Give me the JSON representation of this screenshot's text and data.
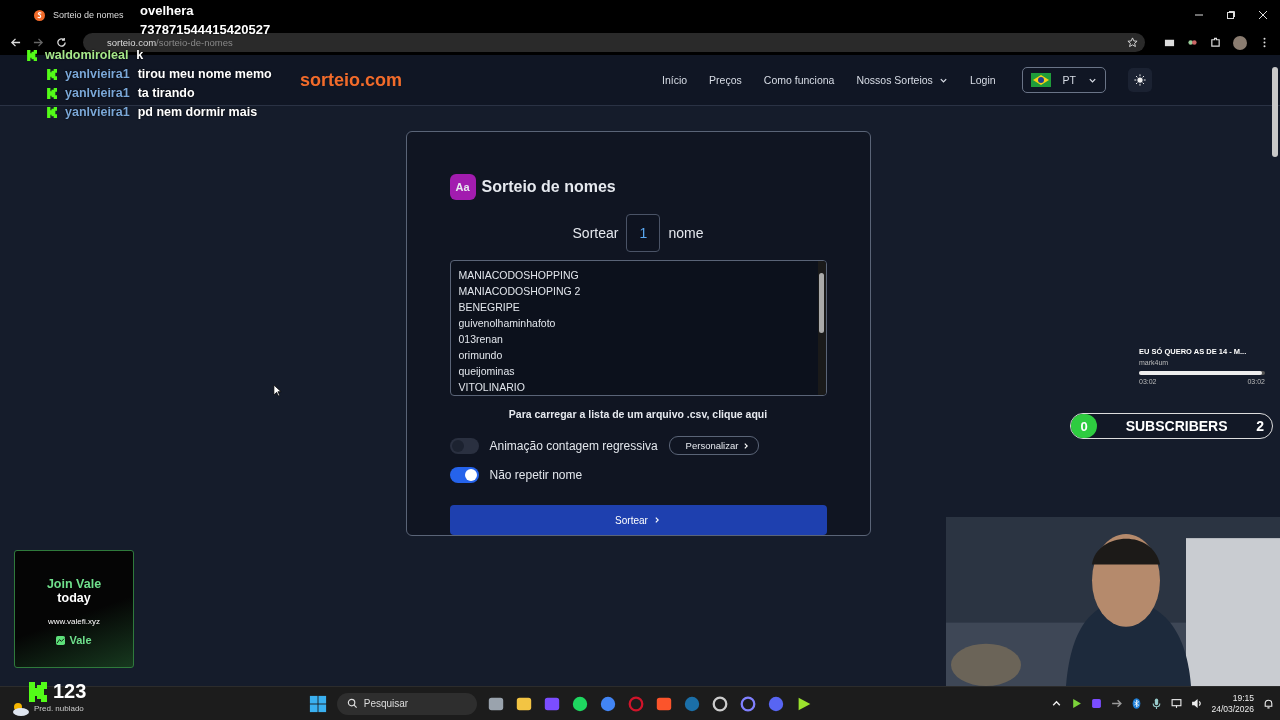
{
  "browser": {
    "tab_title": "Sorteio de nomes",
    "url_domain": "sorteio.com",
    "url_path": "/sorteio-de-nomes"
  },
  "site": {
    "logo": "sorteio.com",
    "nav": [
      {
        "label": "Início",
        "dropdown": false
      },
      {
        "label": "Preços",
        "dropdown": false
      },
      {
        "label": "Como funciona",
        "dropdown": false
      },
      {
        "label": "Nossos Sorteios",
        "dropdown": true
      },
      {
        "label": "Login",
        "dropdown": false
      }
    ],
    "language": "PT"
  },
  "card": {
    "icon_text": "Aa",
    "title": "Sorteio de nomes",
    "draw_prefix": "Sortear",
    "count": "1",
    "draw_suffix": "nome",
    "names": [
      "MANIACODOSHOPPING",
      "MANIACODOSHOPING 2",
      "BENEGRIPE",
      "guivenolhaminhafoto",
      "013renan",
      "orimundo",
      "queijominas",
      "VITOLINARIO"
    ],
    "csv_hint": "Para carregar a lista de um arquivo .csv, clique aqui",
    "options": [
      {
        "label": "Animação contagem regressiva",
        "on": false,
        "button": "Personalizar"
      },
      {
        "label": "Não repetir nome",
        "on": true
      }
    ],
    "submit": "Sortear"
  },
  "overlay": {
    "viewer": {
      "name": "ovelhera",
      "id": "737871544415420527"
    },
    "chat": [
      {
        "user": "waldomiroleal",
        "message": "k",
        "color": "#a6e88a"
      },
      {
        "user": "yanlvieira1",
        "message": "tirou meu nome memo",
        "color": "#7aa7d8"
      },
      {
        "user": "yanlvieira1",
        "message": "ta tirando",
        "color": "#7aa7d8"
      },
      {
        "user": "yanlvieira1",
        "message": "pd nem dormir mais",
        "color": "#7aa7d8"
      }
    ],
    "music": {
      "title": "EU SÓ QUERO AS DE 14 - M...",
      "artist": "mark4um",
      "level": 0.98,
      "elapsed": "03:02",
      "total": "03:02"
    },
    "subscribers": {
      "current": "0",
      "label": "SUBSCRIBERS",
      "goal": "2"
    },
    "ad": {
      "line1": "Join Vale",
      "line2": "today",
      "url": "www.valefi.xyz",
      "brand": "Vale"
    },
    "follower_count": "123"
  },
  "taskbar": {
    "weather": "Pred. nublado",
    "search_placeholder": "Pesquisar",
    "time": "19:15",
    "date": "24/03/2026"
  }
}
